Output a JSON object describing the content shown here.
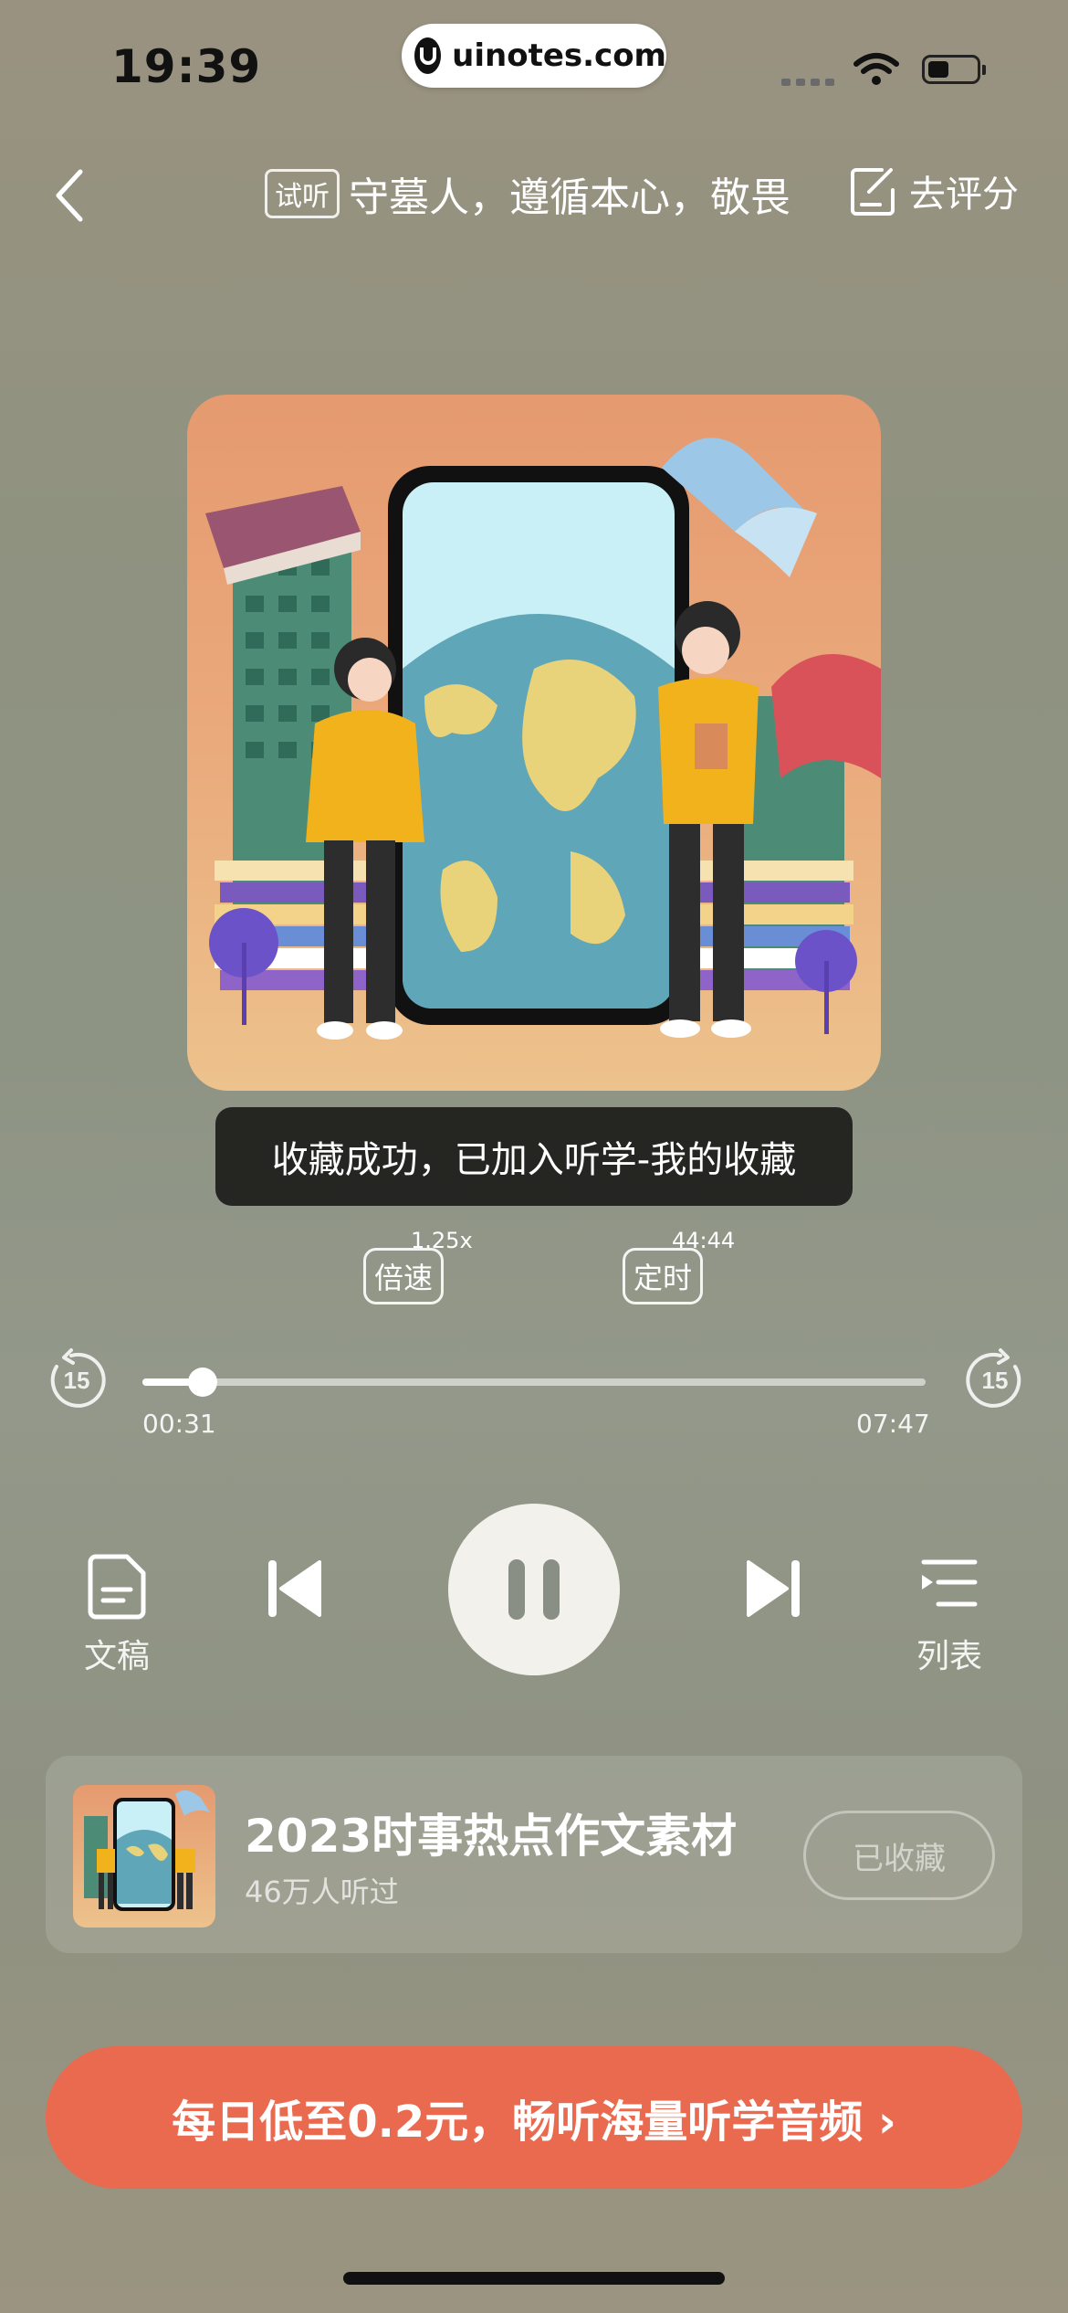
{
  "status_bar": {
    "time": "19:39",
    "url": "uinotes.com"
  },
  "header": {
    "trial_badge": "试听",
    "title": "守墓人，遵循本心，敬畏",
    "rate_label": "去评分"
  },
  "toast": {
    "text": "收藏成功，已加入听学-我的收藏"
  },
  "speed": {
    "label": "倍速",
    "value": "1.25x"
  },
  "timer": {
    "label": "定时",
    "value": "44:44"
  },
  "player": {
    "rewind_seconds": "15",
    "forward_seconds": "15",
    "current_time": "00:31",
    "total_time": "07:47",
    "progress_fraction": 0.077
  },
  "controls": {
    "transcript_label": "文稿",
    "playlist_label": "列表"
  },
  "album": {
    "title": "2023时事热点作文素材",
    "listeners": "46万人听过",
    "favorite_label": "已收藏"
  },
  "cta": {
    "label": "每日低至0.2元，畅听海量听学音频 ›"
  },
  "colors": {
    "cta": "#ea6a50",
    "toast_bg": "#1c1c1a",
    "play_btn": "#f2f1ec"
  }
}
